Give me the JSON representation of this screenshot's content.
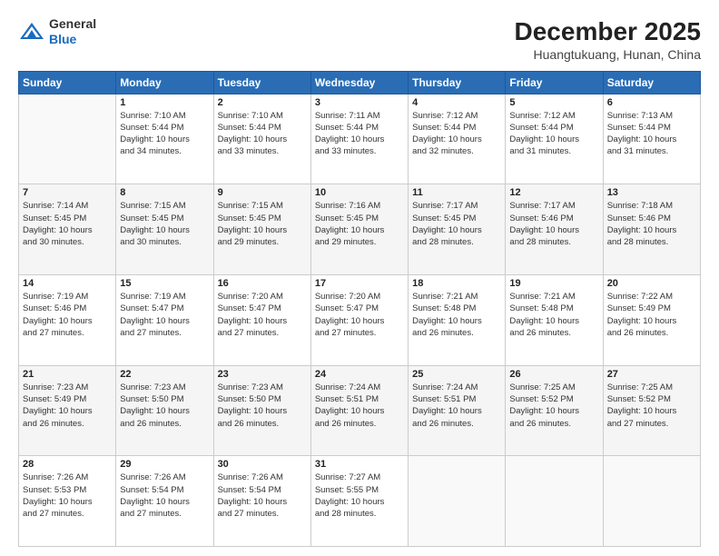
{
  "header": {
    "logo_line1": "General",
    "logo_line2": "Blue",
    "month_title": "December 2025",
    "location": "Huangtukuang, Hunan, China"
  },
  "days_of_week": [
    "Sunday",
    "Monday",
    "Tuesday",
    "Wednesday",
    "Thursday",
    "Friday",
    "Saturday"
  ],
  "weeks": [
    [
      {
        "day": "",
        "info": ""
      },
      {
        "day": "1",
        "info": "Sunrise: 7:10 AM\nSunset: 5:44 PM\nDaylight: 10 hours\nand 34 minutes."
      },
      {
        "day": "2",
        "info": "Sunrise: 7:10 AM\nSunset: 5:44 PM\nDaylight: 10 hours\nand 33 minutes."
      },
      {
        "day": "3",
        "info": "Sunrise: 7:11 AM\nSunset: 5:44 PM\nDaylight: 10 hours\nand 33 minutes."
      },
      {
        "day": "4",
        "info": "Sunrise: 7:12 AM\nSunset: 5:44 PM\nDaylight: 10 hours\nand 32 minutes."
      },
      {
        "day": "5",
        "info": "Sunrise: 7:12 AM\nSunset: 5:44 PM\nDaylight: 10 hours\nand 31 minutes."
      },
      {
        "day": "6",
        "info": "Sunrise: 7:13 AM\nSunset: 5:44 PM\nDaylight: 10 hours\nand 31 minutes."
      }
    ],
    [
      {
        "day": "7",
        "info": "Sunrise: 7:14 AM\nSunset: 5:45 PM\nDaylight: 10 hours\nand 30 minutes."
      },
      {
        "day": "8",
        "info": "Sunrise: 7:15 AM\nSunset: 5:45 PM\nDaylight: 10 hours\nand 30 minutes."
      },
      {
        "day": "9",
        "info": "Sunrise: 7:15 AM\nSunset: 5:45 PM\nDaylight: 10 hours\nand 29 minutes."
      },
      {
        "day": "10",
        "info": "Sunrise: 7:16 AM\nSunset: 5:45 PM\nDaylight: 10 hours\nand 29 minutes."
      },
      {
        "day": "11",
        "info": "Sunrise: 7:17 AM\nSunset: 5:45 PM\nDaylight: 10 hours\nand 28 minutes."
      },
      {
        "day": "12",
        "info": "Sunrise: 7:17 AM\nSunset: 5:46 PM\nDaylight: 10 hours\nand 28 minutes."
      },
      {
        "day": "13",
        "info": "Sunrise: 7:18 AM\nSunset: 5:46 PM\nDaylight: 10 hours\nand 28 minutes."
      }
    ],
    [
      {
        "day": "14",
        "info": "Sunrise: 7:19 AM\nSunset: 5:46 PM\nDaylight: 10 hours\nand 27 minutes."
      },
      {
        "day": "15",
        "info": "Sunrise: 7:19 AM\nSunset: 5:47 PM\nDaylight: 10 hours\nand 27 minutes."
      },
      {
        "day": "16",
        "info": "Sunrise: 7:20 AM\nSunset: 5:47 PM\nDaylight: 10 hours\nand 27 minutes."
      },
      {
        "day": "17",
        "info": "Sunrise: 7:20 AM\nSunset: 5:47 PM\nDaylight: 10 hours\nand 27 minutes."
      },
      {
        "day": "18",
        "info": "Sunrise: 7:21 AM\nSunset: 5:48 PM\nDaylight: 10 hours\nand 26 minutes."
      },
      {
        "day": "19",
        "info": "Sunrise: 7:21 AM\nSunset: 5:48 PM\nDaylight: 10 hours\nand 26 minutes."
      },
      {
        "day": "20",
        "info": "Sunrise: 7:22 AM\nSunset: 5:49 PM\nDaylight: 10 hours\nand 26 minutes."
      }
    ],
    [
      {
        "day": "21",
        "info": "Sunrise: 7:23 AM\nSunset: 5:49 PM\nDaylight: 10 hours\nand 26 minutes."
      },
      {
        "day": "22",
        "info": "Sunrise: 7:23 AM\nSunset: 5:50 PM\nDaylight: 10 hours\nand 26 minutes."
      },
      {
        "day": "23",
        "info": "Sunrise: 7:23 AM\nSunset: 5:50 PM\nDaylight: 10 hours\nand 26 minutes."
      },
      {
        "day": "24",
        "info": "Sunrise: 7:24 AM\nSunset: 5:51 PM\nDaylight: 10 hours\nand 26 minutes."
      },
      {
        "day": "25",
        "info": "Sunrise: 7:24 AM\nSunset: 5:51 PM\nDaylight: 10 hours\nand 26 minutes."
      },
      {
        "day": "26",
        "info": "Sunrise: 7:25 AM\nSunset: 5:52 PM\nDaylight: 10 hours\nand 26 minutes."
      },
      {
        "day": "27",
        "info": "Sunrise: 7:25 AM\nSunset: 5:52 PM\nDaylight: 10 hours\nand 27 minutes."
      }
    ],
    [
      {
        "day": "28",
        "info": "Sunrise: 7:26 AM\nSunset: 5:53 PM\nDaylight: 10 hours\nand 27 minutes."
      },
      {
        "day": "29",
        "info": "Sunrise: 7:26 AM\nSunset: 5:54 PM\nDaylight: 10 hours\nand 27 minutes."
      },
      {
        "day": "30",
        "info": "Sunrise: 7:26 AM\nSunset: 5:54 PM\nDaylight: 10 hours\nand 27 minutes."
      },
      {
        "day": "31",
        "info": "Sunrise: 7:27 AM\nSunset: 5:55 PM\nDaylight: 10 hours\nand 28 minutes."
      },
      {
        "day": "",
        "info": ""
      },
      {
        "day": "",
        "info": ""
      },
      {
        "day": "",
        "info": ""
      }
    ]
  ]
}
